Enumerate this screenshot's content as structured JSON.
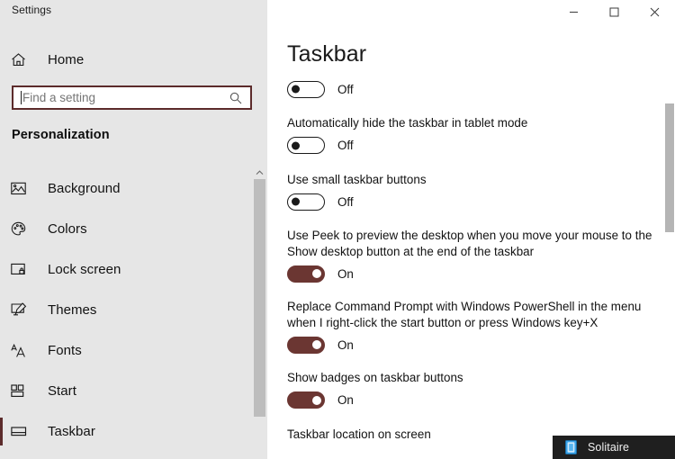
{
  "app": {
    "title": "Settings"
  },
  "window_controls": {
    "minimize": "─",
    "maximize": "□",
    "close": "✕"
  },
  "sidebar": {
    "home_label": "Home",
    "home_icon": "home-icon",
    "search": {
      "placeholder": "Find a setting",
      "value": "",
      "icon": "search-icon"
    },
    "section_title": "Personalization",
    "items": [
      {
        "label": "Background",
        "icon": "image-icon",
        "selected": false
      },
      {
        "label": "Colors",
        "icon": "palette-icon",
        "selected": false
      },
      {
        "label": "Lock screen",
        "icon": "lock-screen-icon",
        "selected": false
      },
      {
        "label": "Themes",
        "icon": "themes-icon",
        "selected": false
      },
      {
        "label": "Fonts",
        "icon": "fonts-icon",
        "selected": false
      },
      {
        "label": "Start",
        "icon": "start-tiles-icon",
        "selected": false
      },
      {
        "label": "Taskbar",
        "icon": "taskbar-icon",
        "selected": true
      }
    ]
  },
  "main": {
    "page_title": "Taskbar",
    "settings": [
      {
        "label": "",
        "state": "Off",
        "on": false
      },
      {
        "label": "Automatically hide the taskbar in tablet mode",
        "state": "Off",
        "on": false
      },
      {
        "label": "Use small taskbar buttons",
        "state": "Off",
        "on": false
      },
      {
        "label": "Use Peek to preview the desktop when you move your mouse to the Show desktop button at the end of the taskbar",
        "state": "On",
        "on": true
      },
      {
        "label": "Replace Command Prompt with Windows PowerShell in the menu when I right-click the start button or press Windows key+X",
        "state": "On",
        "on": true
      },
      {
        "label": "Show badges on taskbar buttons",
        "state": "On",
        "on": true
      }
    ],
    "trailing_label": "Taskbar location on screen"
  },
  "taskbar": {
    "item_label": "Solitaire",
    "item_icon": "solitaire-icon"
  },
  "colors": {
    "accent": "#6b3632",
    "selection_bar": "#5c2b2b",
    "sidebar_bg": "#e6e6e6",
    "main_bg": "#ffffff",
    "taskbar_bg": "#1f1f1f"
  }
}
